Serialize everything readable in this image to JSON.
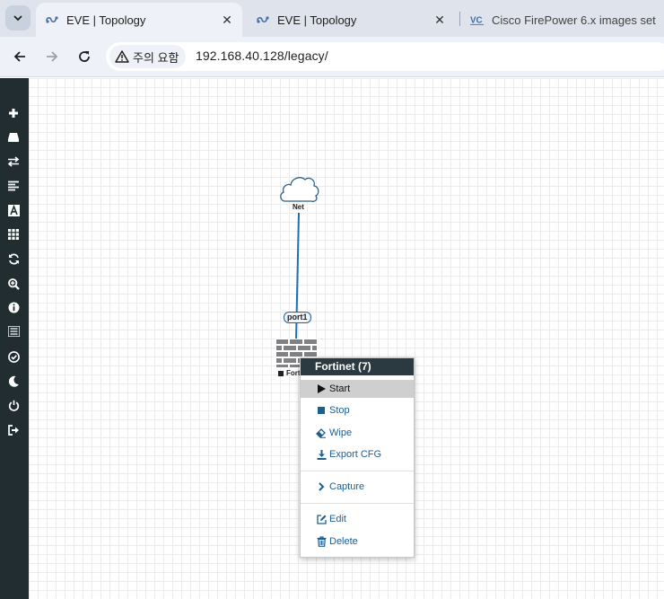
{
  "browser": {
    "tabs": [
      {
        "title": "EVE | Topology",
        "active": true
      },
      {
        "title": "EVE | Topology",
        "active": false
      },
      {
        "title": "Cisco FirePower 6.x images set",
        "active": false
      }
    ],
    "security_chip": "주의 요함",
    "url": "192.168.40.128/legacy/"
  },
  "sidebar": {
    "icons": [
      "plus-icon",
      "hdd-icon",
      "exchange-icon",
      "align-left-icon",
      "font-icon",
      "grid-icon",
      "refresh-icon",
      "zoom-in-icon",
      "info-icon",
      "list-icon",
      "check-circle-icon",
      "moon-icon",
      "power-icon",
      "logout-icon"
    ]
  },
  "topology": {
    "cloud_label": "Net",
    "port_label": "port1",
    "node_label": "Fortinet",
    "node_label_visible": "Forti",
    "link_color": "#1f6fae"
  },
  "context_menu": {
    "title": "Fortinet (7)",
    "items": {
      "start": "Start",
      "stop": "Stop",
      "wipe": "Wipe",
      "export": "Export CFG",
      "capture": "Capture",
      "edit": "Edit",
      "delete": "Delete"
    }
  }
}
